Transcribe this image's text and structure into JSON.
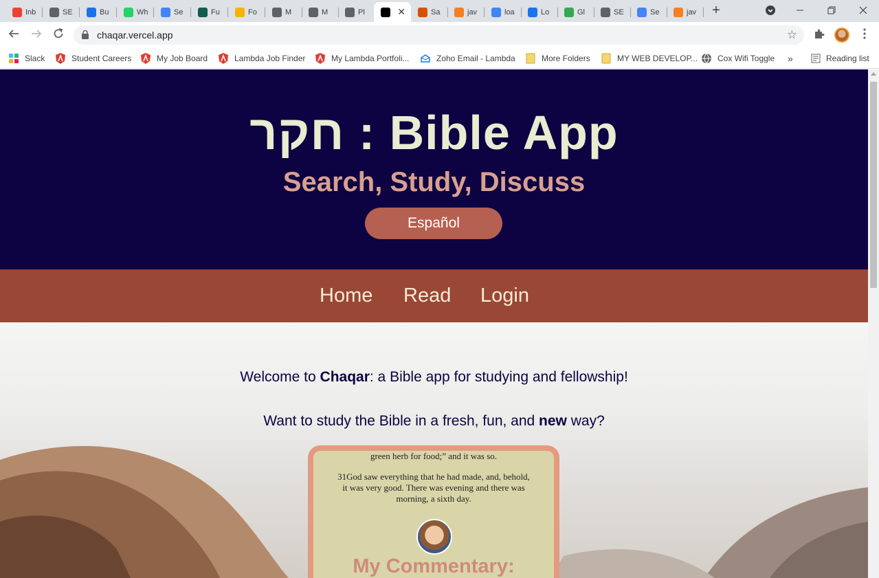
{
  "browser": {
    "tabs": [
      {
        "label": "Inb",
        "icon": "gmail-icon",
        "color": "#ea4335"
      },
      {
        "label": "SE",
        "icon": "globe-icon",
        "color": "#5f6368"
      },
      {
        "label": "Bu",
        "icon": "v-logo-icon",
        "color": "#1a73e8"
      },
      {
        "label": "Wh",
        "icon": "whatsapp-icon",
        "color": "#25d366"
      },
      {
        "label": "Se",
        "icon": "docs-icon",
        "color": "#4285f4"
      },
      {
        "label": "Fu",
        "icon": "c-logo-icon",
        "color": "#0f5e4e"
      },
      {
        "label": "Fo",
        "icon": "numbers-icon",
        "color": "#f4b400"
      },
      {
        "label": "M",
        "icon": "p-logo-icon",
        "color": "#5f6368"
      },
      {
        "label": "M",
        "icon": "p-logo-icon",
        "color": "#5f6368"
      },
      {
        "label": "Pl",
        "icon": "p-logo-icon",
        "color": "#5f6368"
      },
      {
        "label": "",
        "icon": "n-logo-icon",
        "color": "#000000",
        "active": true
      },
      {
        "label": "Sa",
        "icon": "s-logo-icon",
        "color": "#d35400"
      },
      {
        "label": "jav",
        "icon": "stackoverflow-icon",
        "color": "#f48024"
      },
      {
        "label": "loa",
        "icon": "google-icon",
        "color": "#4285f4"
      },
      {
        "label": "Lo",
        "icon": "gif-icon",
        "color": "#1a73e8"
      },
      {
        "label": "Gl",
        "icon": "grid-icon",
        "color": "#34a853"
      },
      {
        "label": "SE",
        "icon": "globe-icon",
        "color": "#5f6368"
      },
      {
        "label": "Se",
        "icon": "docs-icon",
        "color": "#4285f4"
      },
      {
        "label": "jav",
        "icon": "stackoverflow-icon",
        "color": "#f48024"
      }
    ],
    "url": "chaqar.vercel.app",
    "bookmarks": [
      {
        "label": "Slack",
        "icon": "slack-icon",
        "color": "#4a154b"
      },
      {
        "label": "Student Careers",
        "icon": "lambda-icon",
        "color": "#e03c31"
      },
      {
        "label": "My Job Board",
        "icon": "lambda-icon",
        "color": "#e03c31"
      },
      {
        "label": "Lambda Job Finder",
        "icon": "lambda-icon",
        "color": "#e03c31"
      },
      {
        "label": "My Lambda Portfoli...",
        "icon": "lambda-icon",
        "color": "#e03c31"
      },
      {
        "label": "Zoho Email - Lambda",
        "icon": "zoho-icon",
        "color": "#1a73e8"
      },
      {
        "label": "More Folders",
        "icon": "folder-icon",
        "color": "#f5d76e"
      },
      {
        "label": "MY WEB DEVELOP...",
        "icon": "folder-icon",
        "color": "#f5d76e"
      },
      {
        "label": "Cox Wifi Toggle",
        "icon": "globe-icon",
        "color": "#5f6368"
      }
    ],
    "overflow_label": "»",
    "reading_list": "Reading list"
  },
  "hero": {
    "title": "חקר : Bible App",
    "subtitle": "Search, Study, Discuss",
    "language_button": "Español"
  },
  "nav": {
    "home": "Home",
    "read": "Read",
    "login": "Login"
  },
  "intro": {
    "welcome_prefix": "Welcome to ",
    "welcome_brand": "Chaqar",
    "welcome_suffix": ": a Bible app for studying and fellowship!",
    "question_prefix": "Want to study the Bible in a fresh, fun, and ",
    "question_bold": "new",
    "question_suffix": " way?"
  },
  "preview_card": {
    "verse_tail": "green herb for food;” and it was so.",
    "verse_31": "31God saw everything that he had made, and, behold, it was very good. There was evening and there was morning, a sixth day.",
    "commentary_heading": "My Commentary:"
  },
  "colors": {
    "hero_bg": "#0d0242",
    "title": "#e9ecd0",
    "subtitle": "#d9a090",
    "button": "#b56050",
    "navbar": "#9a4736",
    "card_border": "#e49a80"
  }
}
